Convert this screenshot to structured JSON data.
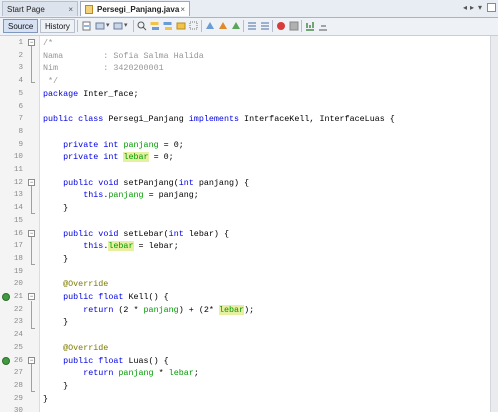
{
  "tabs": [
    {
      "label": "Start Page",
      "close": "×",
      "active": false
    },
    {
      "label": "Persegi_Panjang.java",
      "close": "×",
      "active": true
    }
  ],
  "toolbar": {
    "source_label": "Source",
    "history_label": "History"
  },
  "code": [
    {
      "n": "1",
      "s": [
        {
          "c": "cm",
          "t": "/*"
        }
      ]
    },
    {
      "n": "2",
      "s": [
        {
          "c": "cm",
          "t": "Nama        : Sofia Salma Halida"
        }
      ]
    },
    {
      "n": "3",
      "s": [
        {
          "c": "cm",
          "t": "Nim         : 3420200001"
        }
      ]
    },
    {
      "n": "4",
      "s": [
        {
          "c": "cm",
          "t": " */"
        }
      ]
    },
    {
      "n": "5",
      "s": [
        {
          "c": "kw",
          "t": "package"
        },
        {
          "c": "",
          "t": " Inter_face;"
        }
      ]
    },
    {
      "n": "6",
      "s": []
    },
    {
      "n": "7",
      "s": [
        {
          "c": "kw",
          "t": "public class"
        },
        {
          "c": "",
          "t": " Persegi_Panjang "
        },
        {
          "c": "kw",
          "t": "implements"
        },
        {
          "c": "",
          "t": " InterfaceKell, InterfaceLuas {"
        }
      ]
    },
    {
      "n": "8",
      "s": []
    },
    {
      "n": "9",
      "s": [
        {
          "c": "",
          "t": "    "
        },
        {
          "c": "kw",
          "t": "private int"
        },
        {
          "c": "",
          "t": " "
        },
        {
          "c": "fld",
          "t": "panjang"
        },
        {
          "c": "",
          "t": " = 0;"
        }
      ]
    },
    {
      "n": "10",
      "s": [
        {
          "c": "",
          "t": "    "
        },
        {
          "c": "kw",
          "t": "private int"
        },
        {
          "c": "",
          "t": " "
        },
        {
          "c": "fld hl",
          "t": "lebar"
        },
        {
          "c": "",
          "t": " = 0;"
        }
      ]
    },
    {
      "n": "11",
      "s": []
    },
    {
      "n": "12",
      "s": [
        {
          "c": "",
          "t": "    "
        },
        {
          "c": "kw",
          "t": "public void"
        },
        {
          "c": "",
          "t": " setPanjang("
        },
        {
          "c": "kw",
          "t": "int"
        },
        {
          "c": "",
          "t": " panjang) {"
        }
      ]
    },
    {
      "n": "13",
      "s": [
        {
          "c": "",
          "t": "        "
        },
        {
          "c": "kw",
          "t": "this"
        },
        {
          "c": "",
          "t": "."
        },
        {
          "c": "fld",
          "t": "panjang"
        },
        {
          "c": "",
          "t": " = panjang;"
        }
      ]
    },
    {
      "n": "14",
      "s": [
        {
          "c": "",
          "t": "    }"
        }
      ]
    },
    {
      "n": "15",
      "s": []
    },
    {
      "n": "16",
      "s": [
        {
          "c": "",
          "t": "    "
        },
        {
          "c": "kw",
          "t": "public void"
        },
        {
          "c": "",
          "t": " setLebar("
        },
        {
          "c": "kw",
          "t": "int"
        },
        {
          "c": "",
          "t": " lebar) {"
        }
      ]
    },
    {
      "n": "17",
      "s": [
        {
          "c": "",
          "t": "        "
        },
        {
          "c": "kw",
          "t": "this"
        },
        {
          "c": "",
          "t": "."
        },
        {
          "c": "fld hl",
          "t": "lebar"
        },
        {
          "c": "",
          "t": " = lebar;"
        }
      ]
    },
    {
      "n": "18",
      "s": [
        {
          "c": "",
          "t": "    }"
        }
      ]
    },
    {
      "n": "19",
      "s": []
    },
    {
      "n": "20",
      "s": [
        {
          "c": "an",
          "t": "    @Override"
        }
      ]
    },
    {
      "n": "21",
      "s": [
        {
          "c": "",
          "t": "    "
        },
        {
          "c": "kw",
          "t": "public float"
        },
        {
          "c": "",
          "t": " Kell() {"
        }
      ]
    },
    {
      "n": "22",
      "s": [
        {
          "c": "",
          "t": "        "
        },
        {
          "c": "kw",
          "t": "return"
        },
        {
          "c": "",
          "t": " (2 * "
        },
        {
          "c": "fld",
          "t": "panjang"
        },
        {
          "c": "",
          "t": ") + (2* "
        },
        {
          "c": "fld hl",
          "t": "lebar"
        },
        {
          "c": "",
          "t": ");"
        }
      ]
    },
    {
      "n": "23",
      "s": [
        {
          "c": "",
          "t": "    }"
        }
      ]
    },
    {
      "n": "24",
      "s": []
    },
    {
      "n": "25",
      "s": [
        {
          "c": "an",
          "t": "    @Override"
        }
      ]
    },
    {
      "n": "26",
      "s": [
        {
          "c": "",
          "t": "    "
        },
        {
          "c": "kw",
          "t": "public float"
        },
        {
          "c": "",
          "t": " Luas() {"
        }
      ]
    },
    {
      "n": "27",
      "s": [
        {
          "c": "",
          "t": "        "
        },
        {
          "c": "kw",
          "t": "return"
        },
        {
          "c": "",
          "t": " "
        },
        {
          "c": "fld",
          "t": "panjang"
        },
        {
          "c": "",
          "t": " * "
        },
        {
          "c": "fld",
          "t": "lebar"
        },
        {
          "c": "",
          "t": ";"
        }
      ]
    },
    {
      "n": "28",
      "s": [
        {
          "c": "",
          "t": "    }"
        }
      ]
    },
    {
      "n": "29",
      "s": [
        {
          "c": "",
          "t": "}"
        }
      ]
    },
    {
      "n": "30",
      "s": []
    }
  ],
  "colors": {
    "keyword": "#0000e6",
    "comment": "#969696",
    "field": "#009900",
    "annotation": "#7a7a00",
    "highlight": "#e6f0a0"
  },
  "toolbar_icons": [
    "last-edit-icon",
    "back-icon",
    "forward-icon",
    "find-prev-icon",
    "find-next-icon",
    "find-sel-icon",
    "toggle-highlight-icon",
    "prev-bookmark-icon",
    "next-bookmark-icon",
    "toggle-bookmark-icon",
    "shift-left-icon",
    "shift-right-icon",
    "start-macro-icon",
    "stop-macro-icon",
    "comment-icon",
    "uncomment-icon"
  ]
}
